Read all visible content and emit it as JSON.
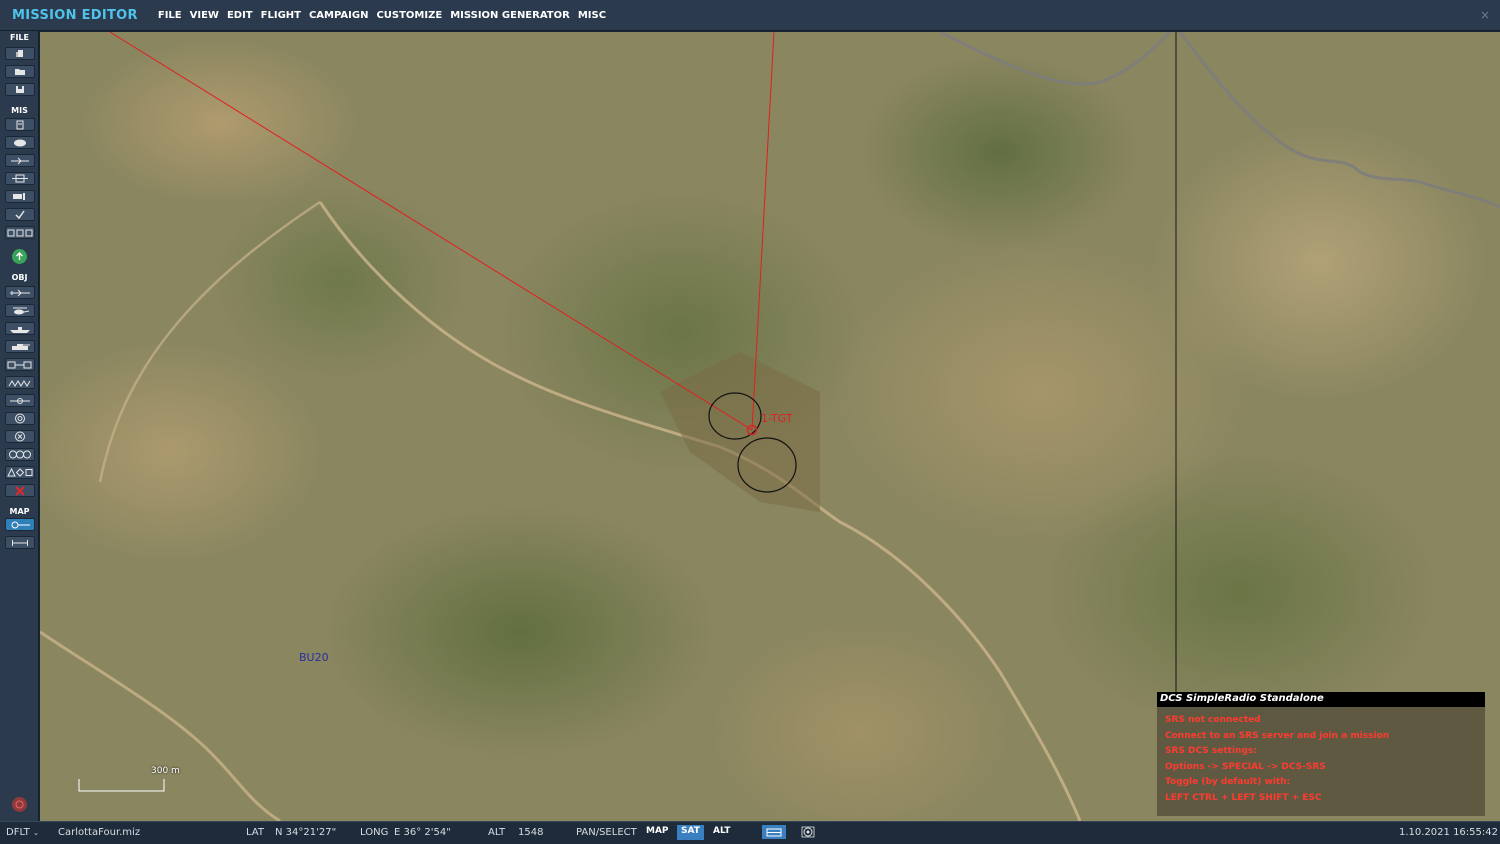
{
  "app": {
    "title": "MISSION EDITOR"
  },
  "menu": [
    "FILE",
    "VIEW",
    "EDIT",
    "FLIGHT",
    "CAMPAIGN",
    "CUSTOMIZE",
    "MISSION GENERATOR",
    "MISC"
  ],
  "window": {
    "close": "×"
  },
  "toolbar": {
    "sections": {
      "file": "FILE",
      "mis": "MIS",
      "obj": "OBJ",
      "map": "MAP"
    },
    "file_tools": [
      "new-mission-icon",
      "open-mission-icon",
      "save-mission-icon"
    ],
    "mis_tools": [
      "briefing-icon",
      "weather-icon",
      "flight-icon",
      "trigger-icon",
      "goals-icon",
      "check-icon",
      "resources-icon"
    ],
    "obj_tools": [
      "airplane-icon",
      "helicopter-icon",
      "ship-icon",
      "vehicle-icon",
      "static-object-icon",
      "trigger-zone-icon",
      "navpoint-icon",
      "target-icon",
      "delete-zone-icon",
      "group-icon",
      "template-icon",
      "delete-icon"
    ],
    "map_tools": [
      "map-option-icon",
      "ruler-icon"
    ]
  },
  "map": {
    "unit_label": "BU20",
    "target_label": "1-TGT",
    "scale_label": "300 m"
  },
  "srs_panel": {
    "title": "DCS SimpleRadio Standalone",
    "lines": [
      "SRS not connected",
      "Connect to an SRS server and join a mission",
      "SRS DCS settings:",
      "Options -> SPECIAL -> DCS-SRS",
      "Toggle (by default) with:",
      "LEFT CTRL + LEFT SHIFT + ESC"
    ],
    "text_color": "#ff3b30"
  },
  "status": {
    "profile": "DFLT",
    "filename": "CarlottaFour.miz",
    "lat_label": "LAT",
    "lat_value": "N 34°21'27\"",
    "long_label": "LONG",
    "long_value": "E 36° 2'54\"",
    "alt_label": "ALT",
    "alt_value": "1548",
    "mode": "PAN/SELECT",
    "map_btn": "MAP",
    "sat_btn": "SAT",
    "alt_btn": "ALT",
    "datetime": "1.10.2021 16:55:42"
  },
  "colors": {
    "accent": "#4fc3ea",
    "route": "#e02020",
    "active": "#3a7fc0"
  }
}
